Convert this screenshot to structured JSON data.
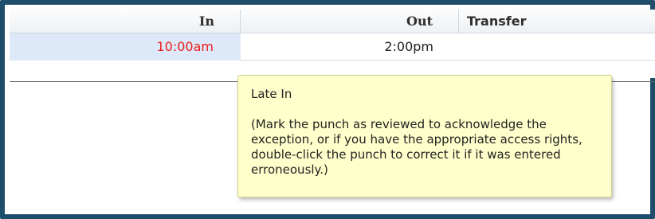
{
  "grid": {
    "columns": {
      "in": "In",
      "out": "Out",
      "transfer": "Transfer"
    },
    "rows": [
      {
        "in": "10:00am",
        "out": "2:00pm",
        "transfer": ""
      }
    ],
    "in_exception_color": "#ea1c1c"
  },
  "tooltip": {
    "title": "Late In",
    "body": "(Mark the punch as reviewed to acknowledge the exception, or if you have the appropriate access rights, double-click the punch to correct it if it was entered erroneously.)"
  }
}
